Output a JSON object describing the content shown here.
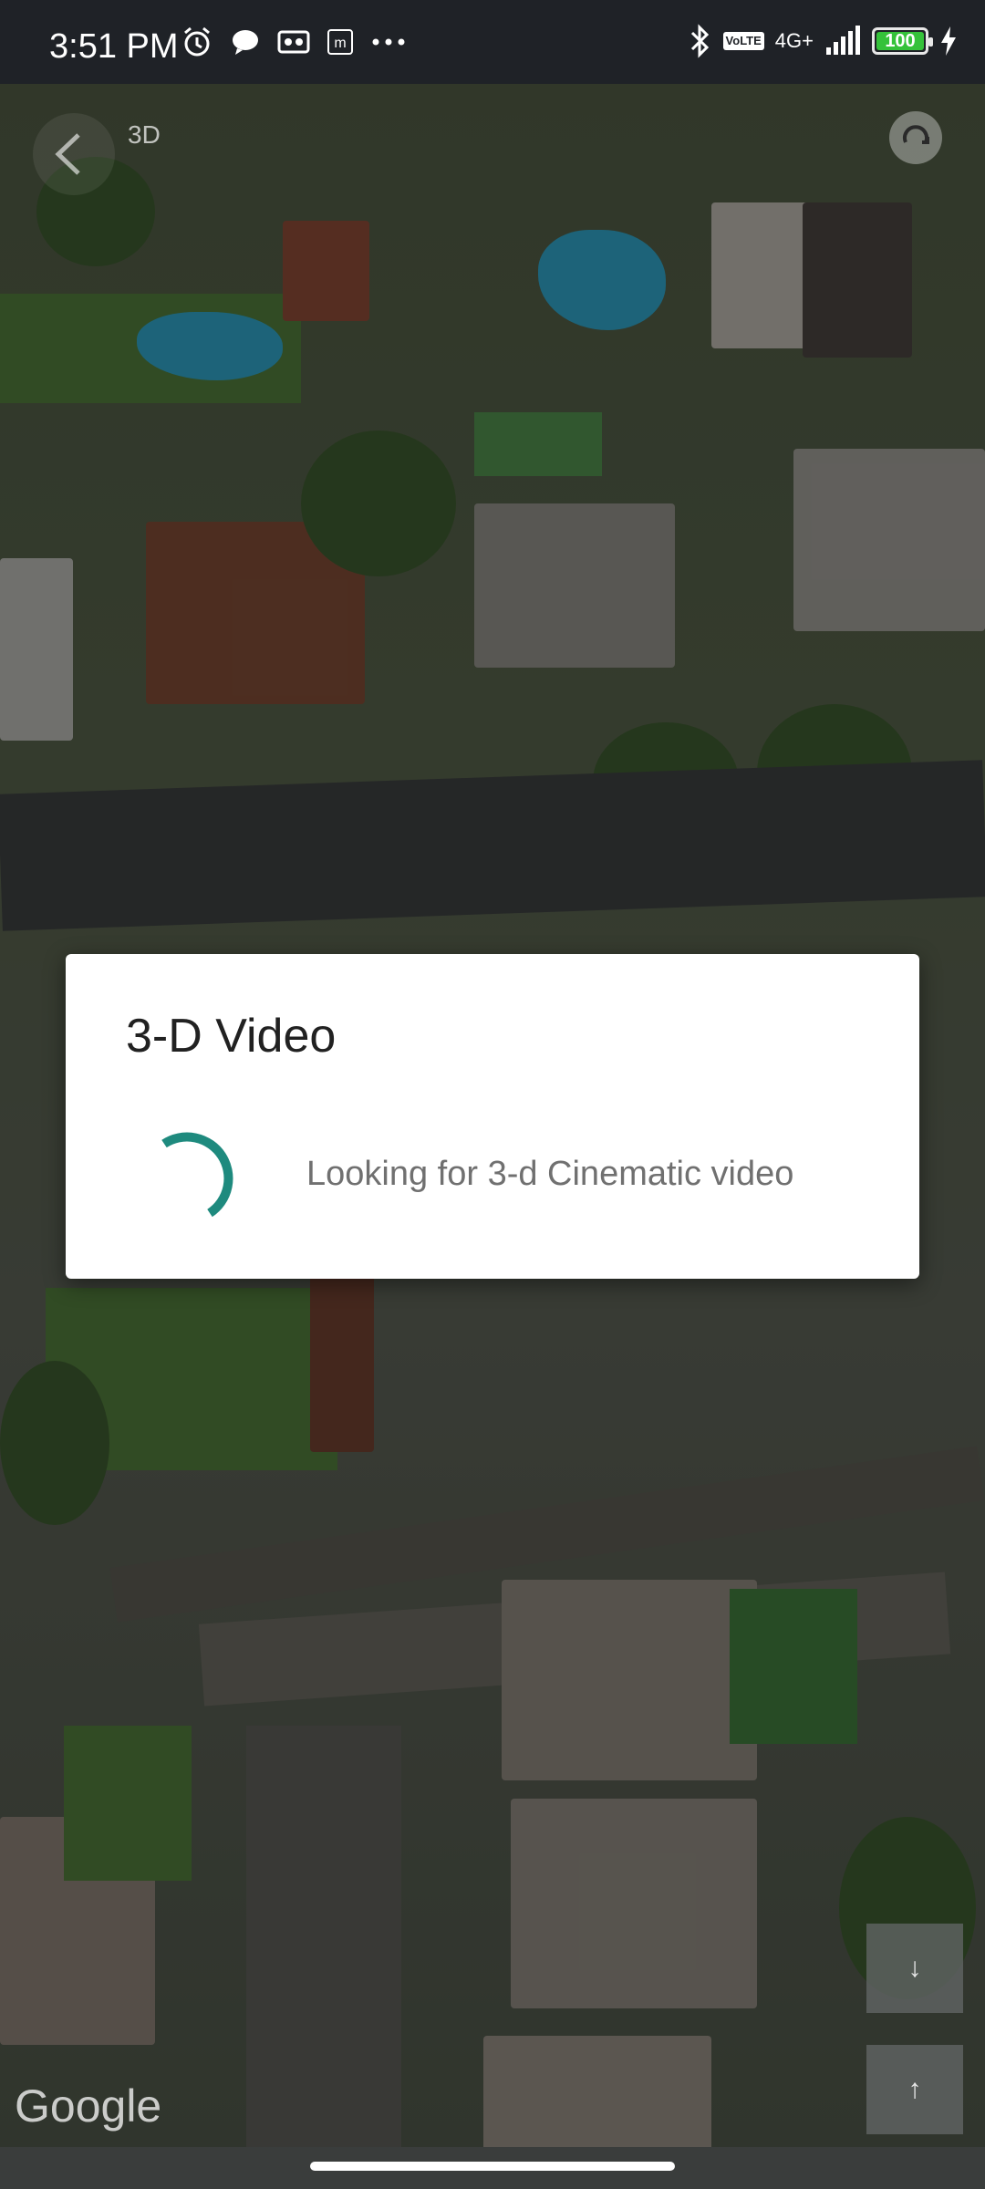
{
  "status_bar": {
    "time": "3:51 PM",
    "left_icons": [
      "alarm-icon",
      "chat-icon",
      "voicemail-icon",
      "m-icon",
      "more-dots-icon"
    ],
    "network": "4G+",
    "volte": "VoLTE",
    "battery": "100",
    "colors": {
      "battery_fill": "#35c23a"
    }
  },
  "map": {
    "view_mode": "3D",
    "attribution": "Google",
    "zoom_in_label": "↓",
    "zoom_out_label": "↑"
  },
  "dialog": {
    "title": "3-D Video",
    "message": "Looking for 3-d Cinematic video",
    "spinner_color": "#1e8a7e"
  }
}
